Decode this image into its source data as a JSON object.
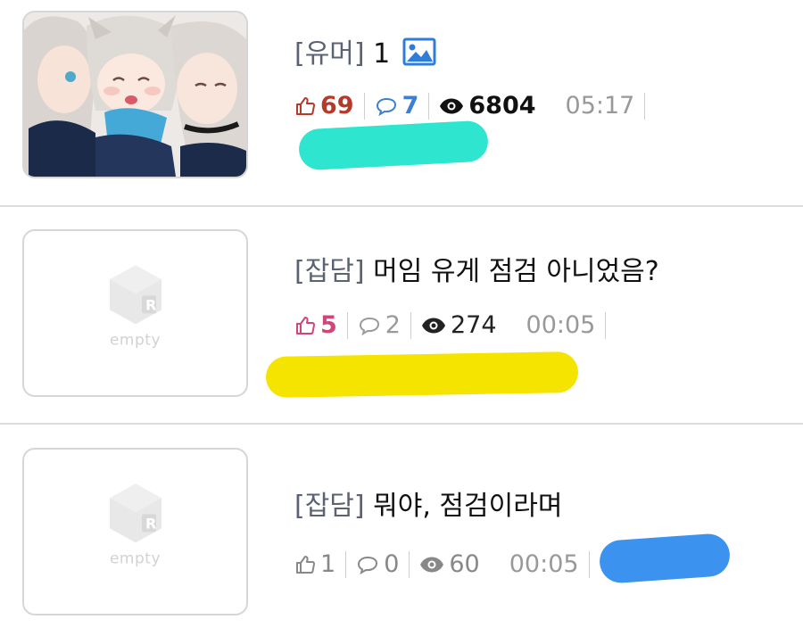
{
  "posts": [
    {
      "category": "[유머]",
      "title": "1",
      "has_image_icon": true,
      "likes": "69",
      "comments": "7",
      "views": "6804",
      "time": "05:17",
      "thumbnail": "anime-girls-illustration",
      "colors": {
        "likes": "#b63a2a",
        "comments": "#3c7fd3",
        "views": "#111111"
      }
    },
    {
      "category": "[잡담]",
      "title": "머임 유게 점검 아니었음?",
      "has_image_icon": false,
      "likes": "5",
      "comments": "2",
      "views": "274",
      "time": "00:05",
      "thumbnail_text": "empty",
      "colors": {
        "likes": "#d1457a",
        "comments": "#9a9a9a",
        "views": "#222222"
      }
    },
    {
      "category": "[잡담]",
      "title": "뭐야, 점검이라며",
      "has_image_icon": false,
      "likes": "1",
      "comments": "0",
      "views": "60",
      "time": "00:05",
      "thumbnail_text": "empty",
      "colors": {
        "likes": "#888888",
        "comments": "#888888",
        "views": "#888888"
      }
    }
  ],
  "redaction_colors": [
    "#2ee6cf",
    "#f5e400",
    "#3b93ef"
  ]
}
